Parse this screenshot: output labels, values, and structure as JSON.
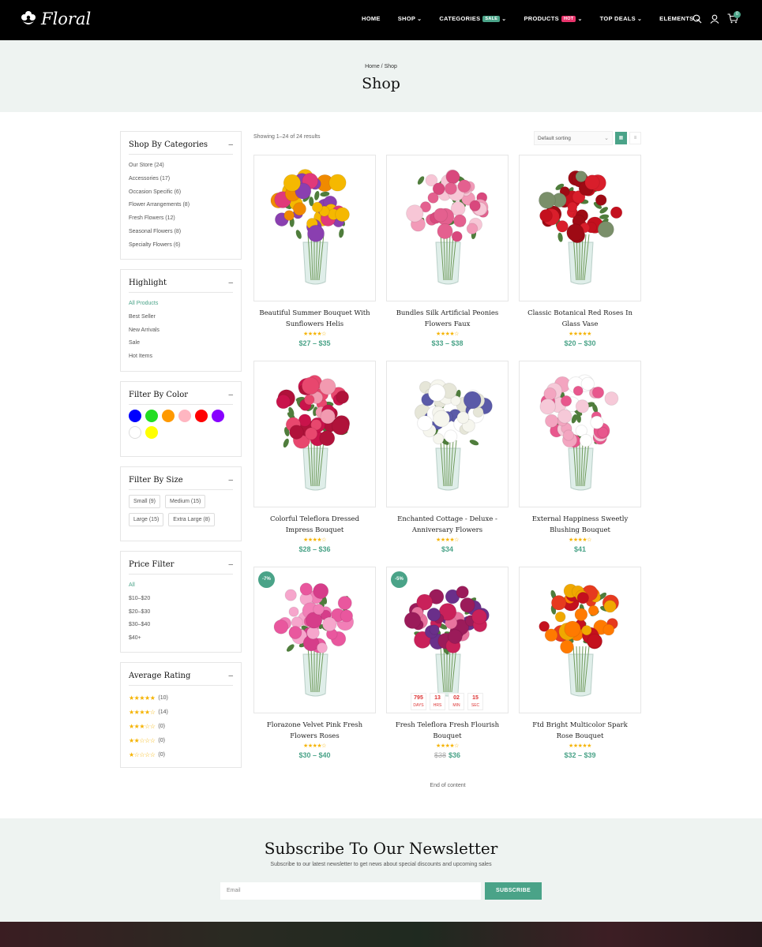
{
  "brand": {
    "name": "Floral"
  },
  "nav": [
    {
      "label": "HOME",
      "chevron": false,
      "badge": ""
    },
    {
      "label": "SHOP",
      "chevron": true,
      "badge": ""
    },
    {
      "label": "CATEGORIES",
      "chevron": true,
      "badge": "SALE",
      "badge_color": "#4aa388"
    },
    {
      "label": "PRODUCTS",
      "chevron": true,
      "badge": "HOT",
      "badge_color": "#e8336b"
    },
    {
      "label": "TOP DEALS",
      "chevron": true,
      "badge": ""
    },
    {
      "label": "ELEMENTS",
      "chevron": true,
      "badge": ""
    }
  ],
  "cart": {
    "count": "0"
  },
  "hero": {
    "breadcrumb": "Home / Shop",
    "title": "Shop"
  },
  "sidebar": {
    "categories": {
      "title": "Shop By Categories",
      "items": [
        "Our Store (24)",
        "Accessories (17)",
        "Occasion Specific (6)",
        "Flower Arrangements (8)",
        "Fresh Flowers (12)",
        "Seasonal Flowers (8)",
        "Specialty Flowers (6)"
      ]
    },
    "highlight": {
      "title": "Highlight",
      "items": [
        "All Products",
        "Best Seller",
        "New Arrivals",
        "Sale",
        "Hot Items"
      ]
    },
    "color": {
      "title": "Filter By Color",
      "swatches": [
        "#0000ff",
        "#22dd22",
        "#ff9900",
        "#ffb6c1",
        "#ff0000",
        "#8800ff",
        "#ffffff",
        "#ffff00"
      ]
    },
    "size": {
      "title": "Filter By Size",
      "items": [
        "Small (9)",
        "Medium (15)",
        "Large (15)",
        "Extra Large (8)"
      ]
    },
    "price": {
      "title": "Price Filter",
      "items": [
        "All",
        "$10–$20",
        "$20–$30",
        "$30–$40",
        "$40+"
      ]
    },
    "rating": {
      "title": "Average Rating",
      "rows": [
        {
          "stars": 5,
          "count": "(10)"
        },
        {
          "stars": 4,
          "count": "(14)"
        },
        {
          "stars": 3,
          "count": "(0)"
        },
        {
          "stars": 2,
          "count": "(0)"
        },
        {
          "stars": 1,
          "count": "(0)"
        }
      ]
    }
  },
  "toolbar": {
    "result": "Showing 1–24 of 24 results",
    "sort": "Default sorting",
    "accent": "#4aa388"
  },
  "products": [
    {
      "name": "Beautiful Summer Bouquet With Sunflowers Helis",
      "stars": 4,
      "price": "$27 – $35",
      "old": "",
      "discount": "",
      "palette": [
        "#f5b800",
        "#e0397a",
        "#8a3fb0",
        "#f08a00"
      ]
    },
    {
      "name": "Bundles Silk Artificial Peonies Flowers Faux",
      "stars": 4,
      "price": "$33 – $38",
      "old": "",
      "discount": "",
      "palette": [
        "#f29ab8",
        "#e4608f",
        "#f7c6d6",
        "#d9487d"
      ]
    },
    {
      "name": "Classic Botanical Red Roses In Glass Vase",
      "stars": 5,
      "price": "$20 – $30",
      "old": "",
      "discount": "",
      "palette": [
        "#c4101e",
        "#9e0a14",
        "#d91e2b",
        "#7a8f6a"
      ]
    },
    {
      "name": "Colorful Teleflora Dressed Impress Bouquet",
      "stars": 4,
      "price": "$28 – $36",
      "old": "",
      "discount": "",
      "palette": [
        "#e8476e",
        "#c9134b",
        "#f29ab0",
        "#b0123a"
      ]
    },
    {
      "name": "Enchanted Cottage - Deluxe - Anniversary Flowers",
      "stars": 4,
      "price": "$34",
      "old": "",
      "discount": "",
      "palette": [
        "#f6f6ee",
        "#e6e6d8",
        "#5a5aa8",
        "#ffffff"
      ]
    },
    {
      "name": "External Happiness Sweetly Blushing Bouquet",
      "stars": 4,
      "price": "$41",
      "old": "",
      "discount": "",
      "palette": [
        "#f3a5c0",
        "#e8578d",
        "#ffffff",
        "#f6c9d8"
      ]
    },
    {
      "name": "Florazone Velvet Pink Fresh Flowers Roses",
      "stars": 4,
      "price": "$30 – $40",
      "old": "",
      "discount": "-7%",
      "palette": [
        "#e9579e",
        "#f27fb7",
        "#d63d8a",
        "#f6a6cc"
      ]
    },
    {
      "name": "Fresh Teleflora Fresh Flourish Bouquet",
      "stars": 4,
      "price": "$36",
      "old": "$38",
      "discount": "-5%",
      "palette": [
        "#9b1b5a",
        "#e8739e",
        "#6a2f8a",
        "#c9215a"
      ],
      "timer": [
        {
          "n": "795",
          "l": "DAYS"
        },
        {
          "n": "13",
          "l": "HRS"
        },
        {
          "n": "02",
          "l": "MIN"
        },
        {
          "n": "15",
          "l": "SEC"
        }
      ]
    },
    {
      "name": "Ftd Bright Multicolor Spark Rose Bouquet",
      "stars": 5,
      "price": "$32 – $39",
      "old": "",
      "discount": "",
      "palette": [
        "#f0a800",
        "#e63a1f",
        "#ff7a00",
        "#c4101e"
      ]
    }
  ],
  "end_text": "End of content",
  "newsletter": {
    "title": "Subscribe To Our Newsletter",
    "subtitle": "Subscribe to our latest newsletter to get news about special discounts and upcoming sales",
    "placeholder": "Email",
    "button": "SUBSCRIBE"
  }
}
